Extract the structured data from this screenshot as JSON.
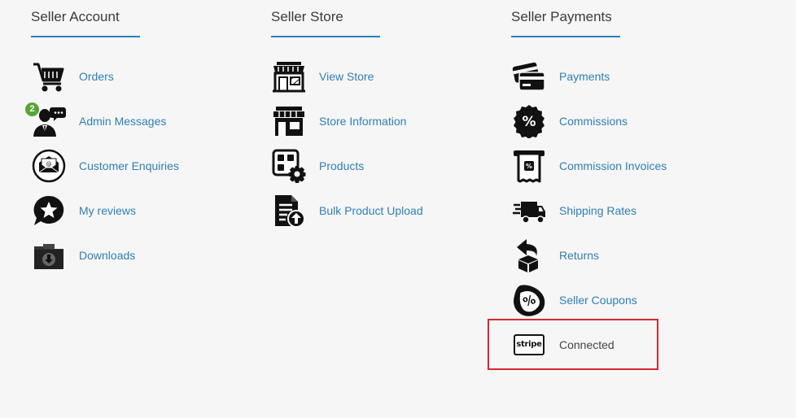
{
  "seller_account": {
    "heading": "Seller Account",
    "items": [
      {
        "label": "Orders",
        "icon": "shopping-cart-icon"
      },
      {
        "label": "Admin Messages",
        "icon": "admin-messages-icon",
        "badge": "2"
      },
      {
        "label": "Customer Enquiries",
        "icon": "email-envelope-icon"
      },
      {
        "label": "My reviews",
        "icon": "star-bubble-icon"
      },
      {
        "label": "Downloads",
        "icon": "download-folder-icon"
      }
    ]
  },
  "seller_store": {
    "heading": "Seller Store",
    "items": [
      {
        "label": "View Store",
        "icon": "storefront-icon"
      },
      {
        "label": "Store Information",
        "icon": "store-info-icon"
      },
      {
        "label": "Products",
        "icon": "products-gear-icon"
      },
      {
        "label": "Bulk Product Upload",
        "icon": "bulk-upload-icon"
      }
    ]
  },
  "seller_payments": {
    "heading": "Seller Payments",
    "items": [
      {
        "label": "Payments",
        "icon": "credit-card-icon"
      },
      {
        "label": "Commissions",
        "icon": "percent-badge-icon"
      },
      {
        "label": "Commission Invoices",
        "icon": "invoice-receipt-icon"
      },
      {
        "label": "Shipping Rates",
        "icon": "delivery-truck-icon"
      },
      {
        "label": "Returns",
        "icon": "return-box-icon"
      },
      {
        "label": "Seller Coupons",
        "icon": "coupon-tag-icon"
      },
      {
        "label": "Connected",
        "icon": "stripe-logo-icon",
        "logo_text": "stripe"
      }
    ]
  },
  "colors": {
    "link": "#2f7fb5",
    "heading": "#3a3a3a",
    "underline": "#2f7fb5",
    "badge": "#56a637",
    "highlight_border": "#d32a2f",
    "background": "#f6f6f6"
  }
}
